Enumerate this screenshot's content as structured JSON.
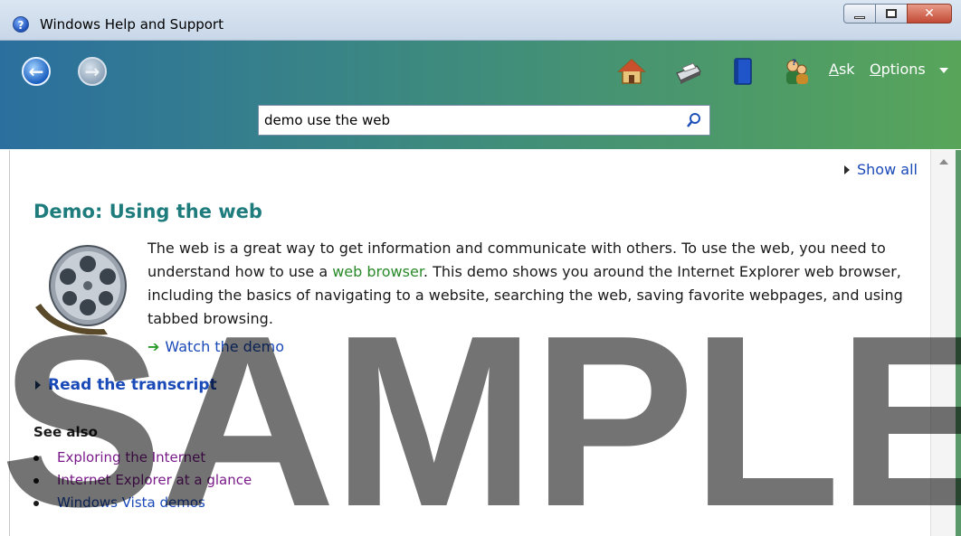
{
  "window": {
    "title": "Windows Help and Support"
  },
  "toolbar": {
    "ask_label": "Ask",
    "ask_accel": "A",
    "ask_rest": "sk",
    "options_label": "Options",
    "options_accel": "O",
    "options_rest": "ptions",
    "icons": [
      "back-arrow-icon",
      "forward-arrow-icon",
      "home-icon",
      "print-icon",
      "browse-help-icon",
      "ask-people-icon"
    ]
  },
  "search": {
    "value": "demo use the web"
  },
  "content": {
    "show_all": "Show all",
    "heading": "Demo: Using the web",
    "paragraph_pre": "The web is a great way to get information and communicate with others. To use the web, you need to understand how to use a ",
    "paragraph_link": "web browser",
    "paragraph_post": ". This demo shows you around the Internet Explorer web browser, including the basics of navigating to a website, searching the web, saving favorite webpages, and using tabbed browsing.",
    "watch_demo": "Watch the demo",
    "read_transcript": "Read the transcript",
    "see_also": "See also",
    "links": [
      {
        "label": "Exploring the Internet",
        "visited": true
      },
      {
        "label": "Internet Explorer at a glance",
        "visited": true
      },
      {
        "label": "Windows Vista demos",
        "visited": false
      }
    ]
  },
  "watermark": "SAMPLE",
  "colors": {
    "heading": "#1f7c7d",
    "link": "#1a49b8",
    "visited_link": "#7a1a8a",
    "inline_link": "#2a8a2a"
  }
}
